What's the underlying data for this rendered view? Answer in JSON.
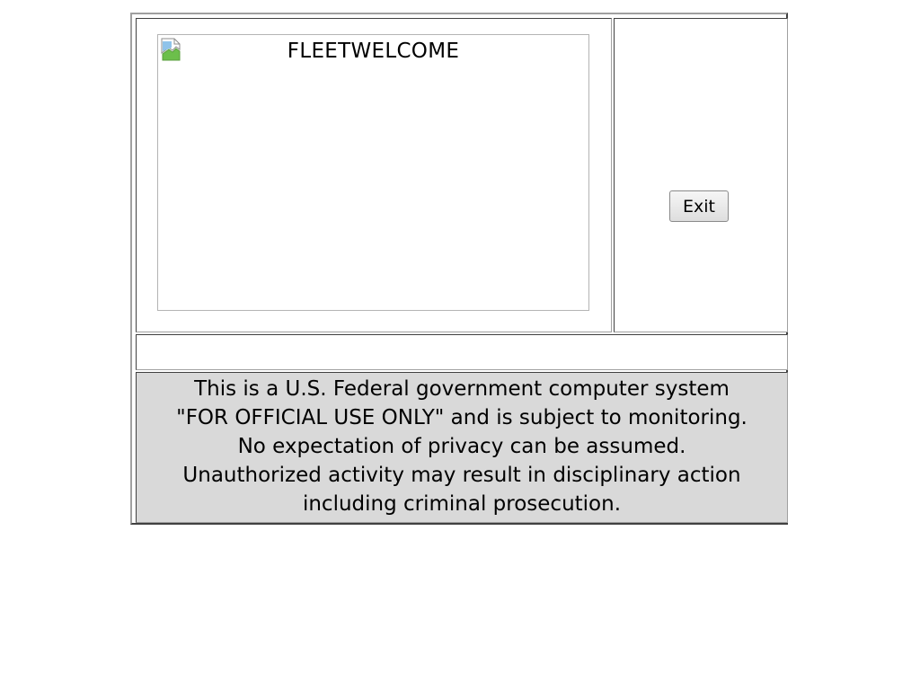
{
  "welcome": {
    "image_alt": "FLEETWELCOME",
    "icon": "broken-image-icon"
  },
  "exit_button": {
    "label": "Exit"
  },
  "notice": {
    "lines": [
      "This is a U.S. Federal government computer system",
      "\"FOR OFFICIAL USE ONLY\" and is subject to monitoring.",
      "No expectation of privacy can be assumed.",
      "Unauthorized activity may result in disciplinary action",
      "including criminal prosecution."
    ]
  },
  "colors": {
    "notice_background": "#d9d9d9",
    "page_background": "#ffffff"
  }
}
